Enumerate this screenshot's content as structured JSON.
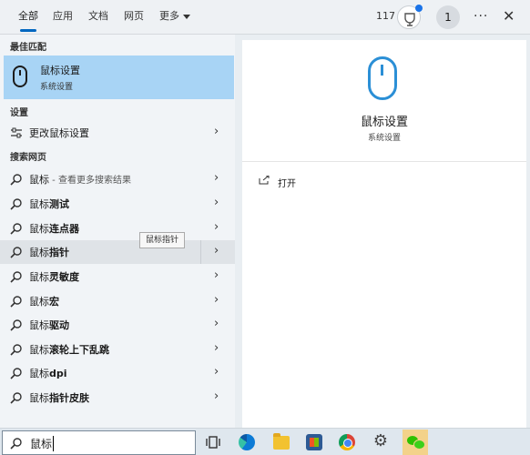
{
  "tabs": [
    {
      "label": "全部",
      "active": true
    },
    {
      "label": "应用"
    },
    {
      "label": "文档"
    },
    {
      "label": "网页"
    },
    {
      "label": "更多"
    }
  ],
  "header": {
    "points": "117",
    "avatar_initial": "1",
    "more_icon": "ellipsis-icon",
    "close_icon": "close-icon"
  },
  "left": {
    "best_match_heading": "最佳匹配",
    "best_match": {
      "title": "鼠标设置",
      "subtitle": "系统设置",
      "icon": "mouse-icon"
    },
    "settings_heading": "设置",
    "settings_items": [
      {
        "label": "更改鼠标设置",
        "icon": "settings-slider-icon"
      }
    ],
    "web_heading": "搜索网页",
    "web_items": [
      {
        "prefix": "鼠标",
        "suffix": " - 查看更多搜索结果",
        "bold": ""
      },
      {
        "prefix": "鼠标",
        "bold": "测试"
      },
      {
        "prefix": "鼠标",
        "bold": "连点器"
      },
      {
        "prefix": "鼠标",
        "bold": "指针"
      },
      {
        "prefix": "鼠标",
        "bold": "灵敏度"
      },
      {
        "prefix": "鼠标",
        "bold": "宏"
      },
      {
        "prefix": "鼠标",
        "bold": "驱动"
      },
      {
        "prefix": "鼠标",
        "bold": "滚轮上下乱跳"
      },
      {
        "prefix": "鼠标",
        "bold": "dpi"
      },
      {
        "prefix": "鼠标",
        "bold": "指针皮肤"
      }
    ],
    "tooltip": "鼠标指针"
  },
  "right": {
    "title": "鼠标设置",
    "subtitle": "系统设置",
    "action_label": "打开"
  },
  "taskbar": {
    "search_value": "鼠标",
    "apps": [
      "task-view-icon",
      "edge-icon",
      "file-explorer-icon",
      "store-icon",
      "chrome-icon",
      "settings-gear-icon",
      "wechat-icon"
    ]
  },
  "colors": {
    "accent": "#0067c0",
    "selected": "#a8d4f5",
    "mouse_icon": "#2b8fd6"
  }
}
